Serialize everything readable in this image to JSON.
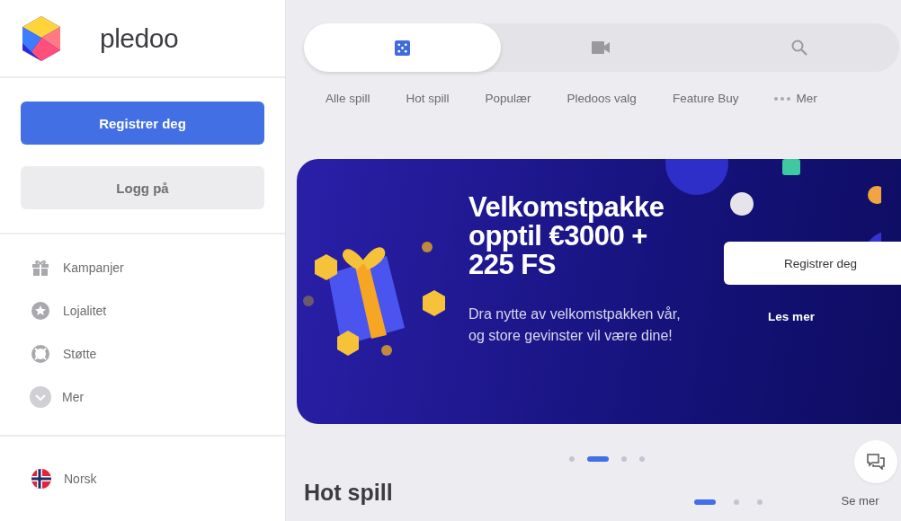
{
  "sidebar": {
    "brand": "pledoo",
    "register_button": "Registrer deg",
    "login_button": "Logg på",
    "items": [
      {
        "kind": "gift",
        "label": "Kampanjer"
      },
      {
        "kind": "star",
        "label": "Lojalitet"
      },
      {
        "kind": "support",
        "label": "Støtte"
      },
      {
        "kind": "more",
        "label": "Mer"
      }
    ],
    "language": "Norsk"
  },
  "mode_tabs": [
    {
      "kind": "dice",
      "selected": true
    },
    {
      "kind": "video",
      "selected": false
    },
    {
      "kind": "search",
      "selected": false
    }
  ],
  "categories": [
    {
      "kind": "link",
      "label": "Alle spill"
    },
    {
      "kind": "link",
      "label": "Hot spill"
    },
    {
      "kind": "link",
      "label": "Populær"
    },
    {
      "kind": "link",
      "label": "Pledoos valg"
    },
    {
      "kind": "link",
      "label": "Feature Buy"
    },
    {
      "kind": "more",
      "label": "Mer"
    }
  ],
  "banner": {
    "title": "Velkomstpakke opptil €3000 + 225 FS",
    "text": "Dra nytte av velkomstpakken vår, og store gevinster vil være dine!",
    "primary_button": "Registrer deg",
    "secondary_link": "Les mer"
  },
  "banner_dots": [
    {
      "selected": false
    },
    {
      "selected": true
    },
    {
      "selected": false
    },
    {
      "selected": false
    }
  ],
  "section": {
    "title": "Hot spill",
    "link": "Se mer",
    "dots": [
      {
        "selected": true
      },
      {
        "selected": false
      },
      {
        "selected": false
      }
    ]
  }
}
